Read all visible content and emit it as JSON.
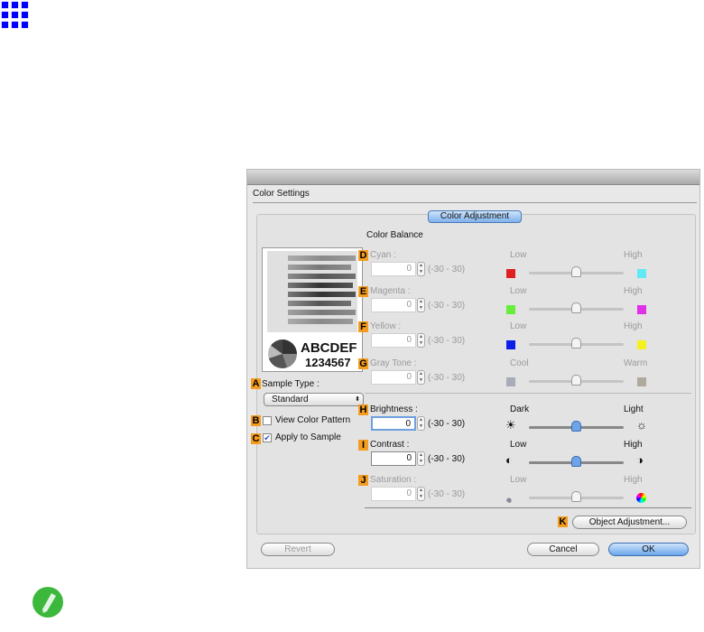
{
  "dialog": {
    "title": "Color Settings",
    "tab": "Color Adjustment",
    "color_balance": "Color Balance",
    "preview": {
      "text1": "ABCDEF",
      "text2": "1234567"
    },
    "sample_type": {
      "badge": "A",
      "label": "Sample Type :",
      "value": "Standard"
    },
    "view_color_pattern": {
      "badge": "B",
      "label": "View Color Pattern",
      "checked": false
    },
    "apply_to_sample": {
      "badge": "C",
      "label": "Apply to Sample",
      "checked": true
    },
    "rows": [
      {
        "badge": "D",
        "label": "Cyan :",
        "value": "0",
        "range": "(-30 - 30)",
        "low": "Low",
        "high": "High",
        "low_color": "#e02020",
        "high_color": "#60eaf5",
        "enabled": false
      },
      {
        "badge": "E",
        "label": "Magenta :",
        "value": "0",
        "range": "(-30 - 30)",
        "low": "Low",
        "high": "High",
        "low_color": "#66ee3a",
        "high_color": "#e030e8",
        "enabled": false
      },
      {
        "badge": "F",
        "label": "Yellow :",
        "value": "0",
        "range": "(-30 - 30)",
        "low": "Low",
        "high": "High",
        "low_color": "#0a1ee8",
        "high_color": "#f5f020",
        "enabled": false
      },
      {
        "badge": "G",
        "label": "Gray Tone :",
        "value": "0",
        "range": "(-30 - 30)",
        "low": "Cool",
        "high": "Warm",
        "low_color": "#a8acb8",
        "high_color": "#b0aa9c",
        "enabled": false
      },
      {
        "badge": "H",
        "label": "Brightness :",
        "value": "0",
        "range": "(-30 - 30)",
        "low": "Dark",
        "high": "Light",
        "low_icon": "☀",
        "high_icon": "☼",
        "enabled": true,
        "focus": true
      },
      {
        "badge": "I",
        "label": "Contrast :",
        "value": "0",
        "range": "(-30 - 30)",
        "low": "Low",
        "high": "High",
        "low_icon": "◐",
        "high_icon": "◑",
        "enabled": true
      },
      {
        "badge": "J",
        "label": "Saturation :",
        "value": "0",
        "range": "(-30 - 30)",
        "low": "Low",
        "high": "High",
        "low_icon": "●",
        "high_icon": "●",
        "enabled": false
      }
    ],
    "object_adjustment": {
      "badge": "K",
      "label": "Object Adjustment..."
    },
    "revert": "Revert",
    "cancel": "Cancel",
    "ok": "OK"
  }
}
